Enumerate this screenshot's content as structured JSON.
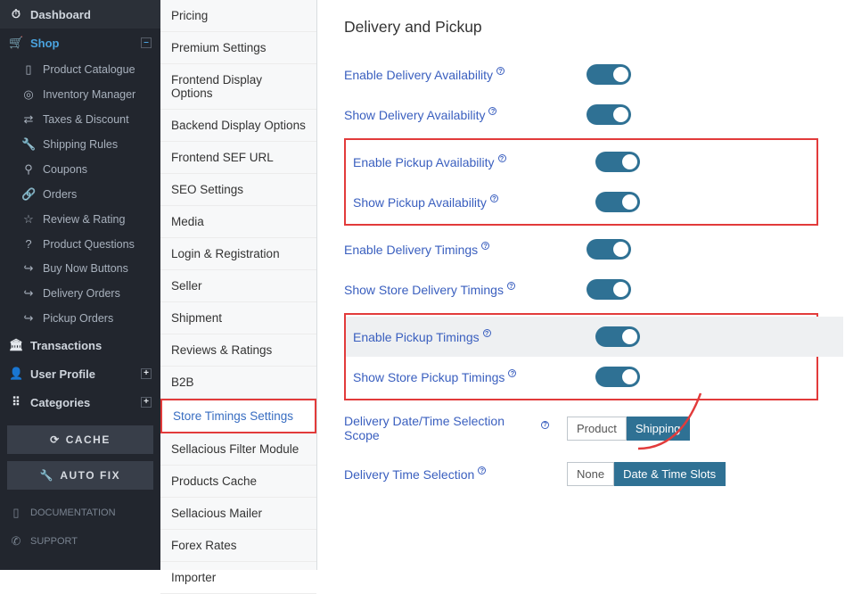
{
  "sidebar": {
    "dashboard": "Dashboard",
    "shop": "Shop",
    "shop_items": [
      "Product Catalogue",
      "Inventory Manager",
      "Taxes & Discount",
      "Shipping Rules",
      "Coupons",
      "Orders",
      "Review & Rating",
      "Product Questions",
      "Buy Now Buttons",
      "Delivery Orders",
      "Pickup Orders"
    ],
    "transactions": "Transactions",
    "user_profile": "User Profile",
    "categories": "Categories",
    "cache_btn": "CACHE",
    "autofix_btn": "AUTO FIX",
    "documentation": "DOCUMENTATION",
    "support": "SUPPORT"
  },
  "mid_sidebar": {
    "items": [
      "Pricing",
      "Premium Settings",
      "Frontend Display Options",
      "Backend Display Options",
      "Frontend SEF URL",
      "SEO Settings",
      "Media",
      "Login & Registration",
      "Seller",
      "Shipment",
      "Reviews & Ratings",
      "B2B",
      "Store Timings Settings",
      "Sellacious Filter Module",
      "Products Cache",
      "Sellacious Mailer",
      "Forex Rates",
      "Importer"
    ],
    "highlighted_index": 12
  },
  "main": {
    "title": "Delivery and Pickup",
    "settings": {
      "enable_delivery_avail": "Enable Delivery Availability",
      "show_delivery_avail": "Show Delivery Availability",
      "enable_pickup_avail": "Enable Pickup Availability",
      "show_pickup_avail": "Show Pickup Availability",
      "enable_delivery_timings": "Enable Delivery Timings",
      "show_store_delivery_timings": "Show Store Delivery Timings",
      "enable_pickup_timings": "Enable Pickup Timings",
      "show_store_pickup_timings": "Show Store Pickup Timings",
      "delivery_scope": "Delivery Date/Time Selection Scope",
      "delivery_time_selection": "Delivery Time Selection"
    },
    "scope_options": {
      "product": "Product",
      "shipping": "Shipping",
      "selected": "shipping"
    },
    "time_options": {
      "none": "None",
      "slots": "Date & Time Slots",
      "selected": "slots"
    }
  }
}
